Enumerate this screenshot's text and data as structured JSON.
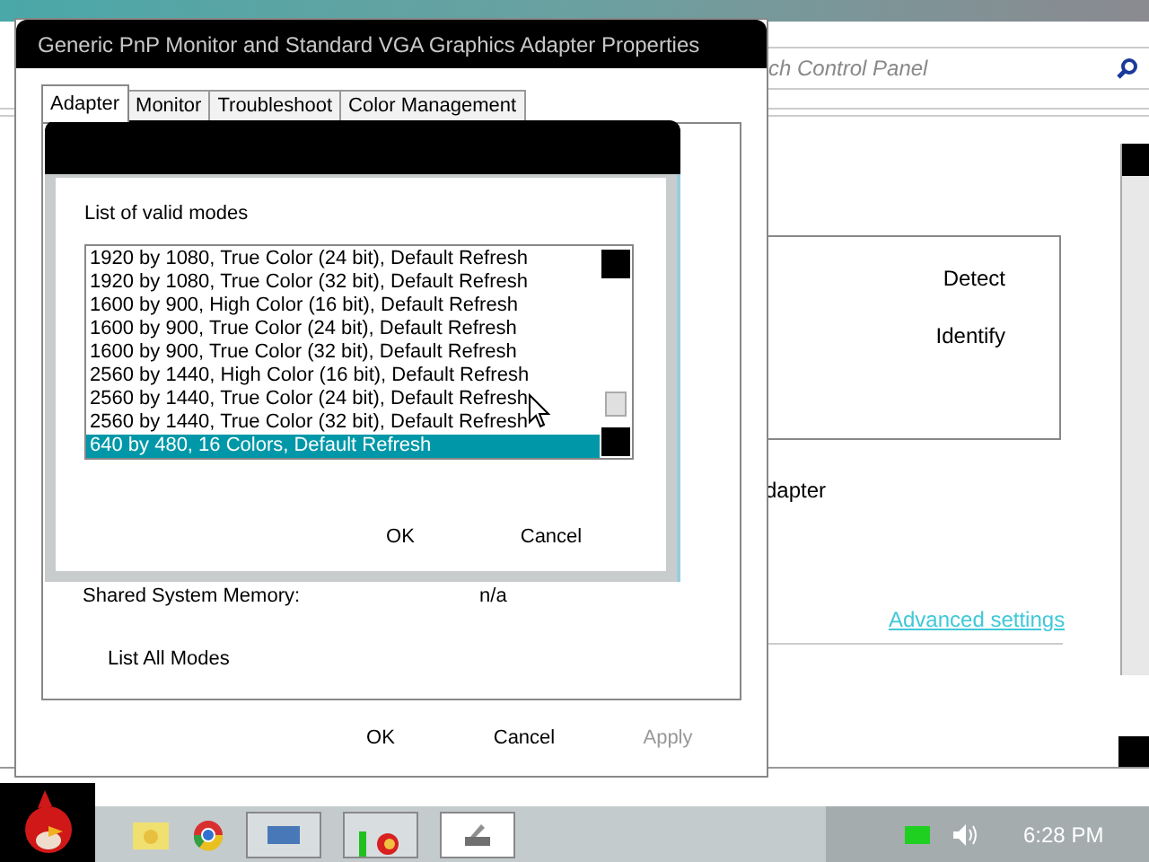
{
  "control_panel": {
    "search": {
      "placeholder": "ch Control Panel"
    },
    "buttons": [
      "Detect",
      "Identify"
    ],
    "label": "dapter",
    "link": "Advanced settings"
  },
  "properties_dialog": {
    "title": "Generic PnP Monitor and Standard VGA Graphics Adapter Properties",
    "tabs": [
      {
        "label": "Adapter",
        "selected": true
      },
      {
        "label": "Monitor",
        "selected": false
      },
      {
        "label": "Troubleshoot",
        "selected": false
      },
      {
        "label": "Color Management",
        "selected": false
      }
    ],
    "memory_label": "Shared System Memory:",
    "memory_value": "n/a",
    "list_all_modes": "List All Modes",
    "buttons": [
      {
        "label": "OK",
        "disabled": false
      },
      {
        "label": "Cancel",
        "disabled": false
      },
      {
        "label": "Apply",
        "disabled": true
      }
    ]
  },
  "modes_dialog": {
    "heading": "List of valid modes",
    "modes": [
      {
        "label": "1920 by 1080, True Color (24 bit), Default Refresh",
        "selected": false
      },
      {
        "label": "1920 by 1080, True Color (32 bit), Default Refresh",
        "selected": false
      },
      {
        "label": "1600 by 900, High Color (16 bit), Default Refresh",
        "selected": false
      },
      {
        "label": "1600 by 900, True Color (24 bit), Default Refresh",
        "selected": false
      },
      {
        "label": "1600 by 900, True Color (32 bit), Default Refresh",
        "selected": false
      },
      {
        "label": "2560 by 1440, High Color (16 bit), Default Refresh",
        "selected": false
      },
      {
        "label": "2560 by 1440, True Color (24 bit), Default Refresh",
        "selected": false
      },
      {
        "label": "2560 by 1440, True Color (32 bit), Default Refresh",
        "selected": false
      },
      {
        "label": "640 by 480, 16 Colors, Default Refresh",
        "selected": true
      }
    ],
    "buttons": [
      "OK",
      "Cancel"
    ]
  },
  "taskbar": {
    "clock": "6:28 PM"
  }
}
